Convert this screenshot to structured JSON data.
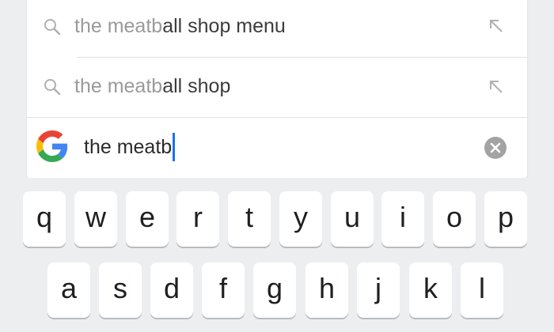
{
  "suggestions": [
    {
      "typed": "the meatb",
      "completion": "all shop menu",
      "icon": "search-icon",
      "action_icon": "arrow-up-left-icon"
    },
    {
      "typed": "the meatb",
      "completion": "all shop",
      "icon": "search-icon",
      "action_icon": "arrow-up-left-icon"
    }
  ],
  "search": {
    "logo": "google-g-logo",
    "query": "the meatb",
    "clear_icon": "clear-icon"
  },
  "keyboard": {
    "row1": [
      "q",
      "w",
      "e",
      "r",
      "t",
      "y",
      "u",
      "i",
      "o",
      "p"
    ],
    "row2": [
      "a",
      "s",
      "d",
      "f",
      "g",
      "h",
      "j",
      "k",
      "l"
    ]
  },
  "colors": {
    "caret": "#1a73e8",
    "google_blue": "#4285F4",
    "google_red": "#EA4335",
    "google_yellow": "#FBBC05",
    "google_green": "#34A853"
  }
}
